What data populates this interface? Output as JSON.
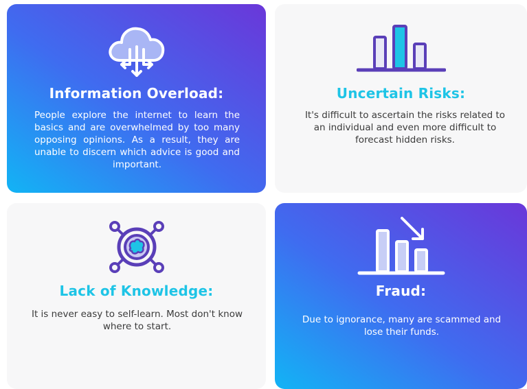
{
  "cards": [
    {
      "title": "Information Overload:",
      "text": "People explore the internet to learn the basics and are overwhelmed by too many opposing opinions. As a result, they are unable to discern which advice is good and important.",
      "icon": "cloud-download-icon"
    },
    {
      "title": "Uncertain Risks:",
      "text": "It's difficult to ascertain the risks related to an individual and even more difficult to forecast hidden risks.",
      "icon": "bar-chart-icon"
    },
    {
      "title": "Lack of Knowledge:",
      "text": "It is never easy to self-learn. Most don't know where to start.",
      "icon": "brain-network-icon"
    },
    {
      "title": "Fraud:",
      "text": "Due to ignorance, many are scammed and lose their funds.",
      "icon": "declining-chart-icon"
    }
  ],
  "colors": {
    "gradient_start": "#12b4f5",
    "gradient_mid": "#3f6cf0",
    "gradient_end": "#6a37d9",
    "accent_cyan": "#1ec4e6",
    "icon_purple": "#5a3fb8",
    "light_card": "#f7f7f8"
  }
}
